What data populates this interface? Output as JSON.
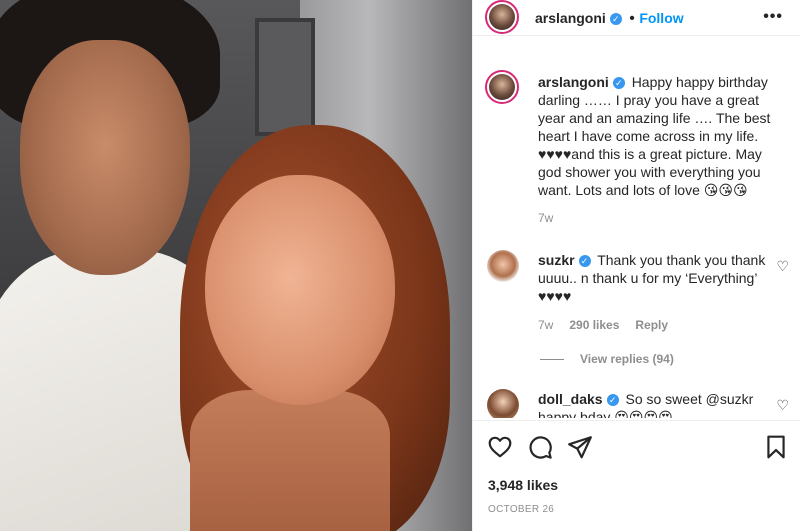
{
  "header": {
    "username": "arslangoni",
    "separator": "•",
    "follow_label": "Follow",
    "more_label": "•••"
  },
  "comments": [
    {
      "username": "arslangoni",
      "text": "Happy happy birthday darling …… I pray you have a great year and an amazing life …. The best heart I have come across in my life. ♥♥♥♥and this is a great picture. May god shower you with everything you want. Lots and lots of love 😘😘😘",
      "time": "7w"
    },
    {
      "username": "suzkr",
      "text": "Thank you thank you thank uuuu.. n thank u for my ‘Everything’ ♥♥♥♥",
      "time": "7w",
      "likes": "290 likes",
      "reply_label": "Reply",
      "view_replies": "View replies (94)"
    },
    {
      "username": "doll_daks",
      "text": "So so sweet @suzkr happy bday 😍😍😍😍"
    }
  ],
  "actions": {
    "likes": "3,948 likes",
    "date": "OCTOBER 26"
  },
  "colors": {
    "accent": "#0095f6",
    "verified": "#3897f0",
    "muted": "#8e8e8e",
    "text": "#262626"
  }
}
